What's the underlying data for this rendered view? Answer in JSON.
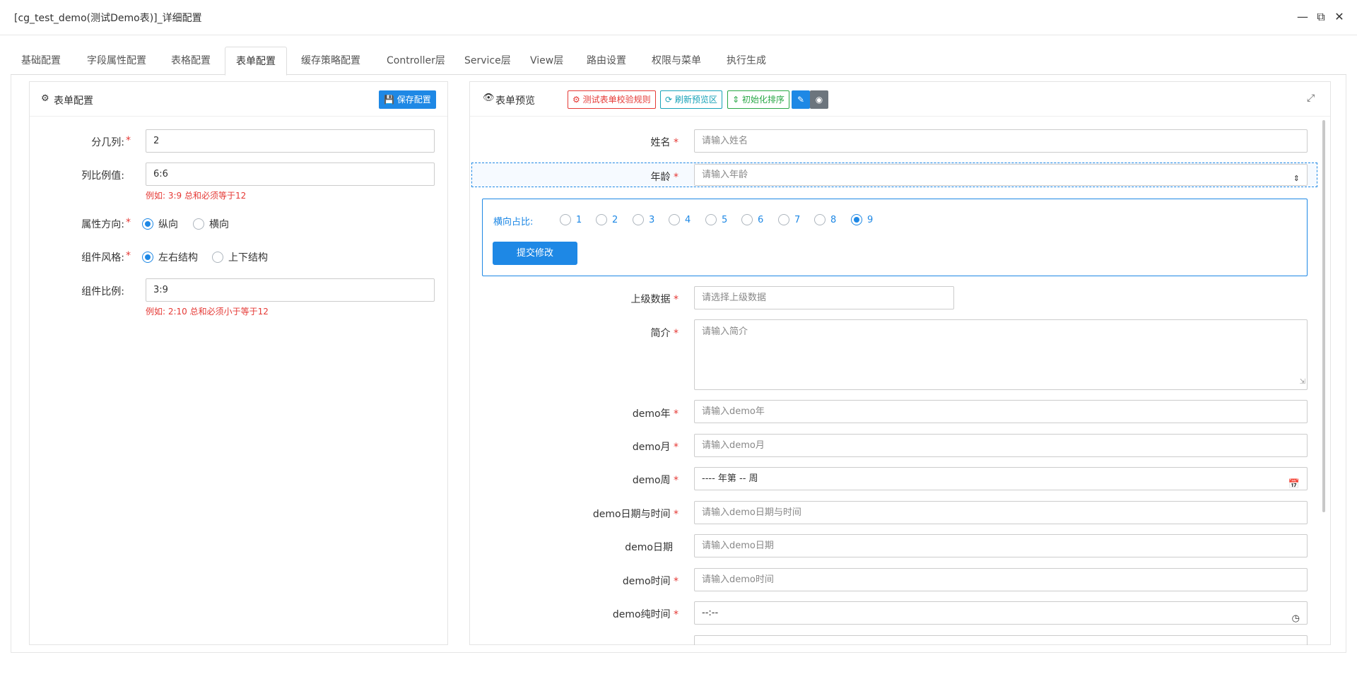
{
  "window": {
    "title": "[cg_test_demo(测试Demo表)]_详细配置"
  },
  "tabs": [
    {
      "label": "基础配置"
    },
    {
      "label": "字段属性配置"
    },
    {
      "label": "表格配置"
    },
    {
      "label": "表单配置"
    },
    {
      "label": "缓存策略配置"
    },
    {
      "label": "Controller层"
    },
    {
      "label": "Service层"
    },
    {
      "label": "View层"
    },
    {
      "label": "路由设置"
    },
    {
      "label": "权限与菜单"
    },
    {
      "label": "执行生成"
    }
  ],
  "left": {
    "title": "表单配置",
    "save_label": "保存配置",
    "fields": {
      "columns": {
        "label": "分几列:",
        "value": "2"
      },
      "ratio": {
        "label": "列比例值:",
        "value": "6:6",
        "hint": "例如: 3:9 总和必须等于12"
      },
      "direction": {
        "label": "属性方向:",
        "options": [
          "纵向",
          "横向"
        ]
      },
      "style": {
        "label": "组件风格:",
        "options": [
          "左右结构",
          "上下结构"
        ]
      },
      "comp_ratio": {
        "label": "组件比例:",
        "value": "3:9",
        "hint": "例如: 2:10 总和必须小于等于12"
      }
    }
  },
  "right": {
    "title": "表单预览",
    "btn_test": "测试表单校验规则",
    "btn_refresh": "刷新预览区",
    "btn_init": "初始化排序",
    "form": [
      {
        "label": "姓名",
        "placeholder": "请输入姓名"
      },
      {
        "label": "年龄",
        "placeholder": "请输入年龄"
      },
      {
        "label": "上级数据",
        "placeholder": "请选择上级数据"
      },
      {
        "label": "简介",
        "placeholder": "请输入简介"
      },
      {
        "label": "demo年",
        "placeholder": "请输入demo年"
      },
      {
        "label": "demo月",
        "placeholder": "请输入demo月"
      },
      {
        "label": "demo周",
        "placeholder": "---- 年第 -- 周"
      },
      {
        "label": "demo日期与时间",
        "placeholder": "请输入demo日期与时间"
      },
      {
        "label": "demo日期",
        "placeholder": "请输入demo日期"
      },
      {
        "label": "demo时间",
        "placeholder": "请输入demo时间"
      },
      {
        "label": "demo纯时间",
        "placeholder": "--:--"
      }
    ],
    "edit_box": {
      "label": "横向占比:",
      "options": [
        "1",
        "2",
        "3",
        "4",
        "5",
        "6",
        "7",
        "8",
        "9"
      ],
      "submit": "提交修改"
    }
  }
}
